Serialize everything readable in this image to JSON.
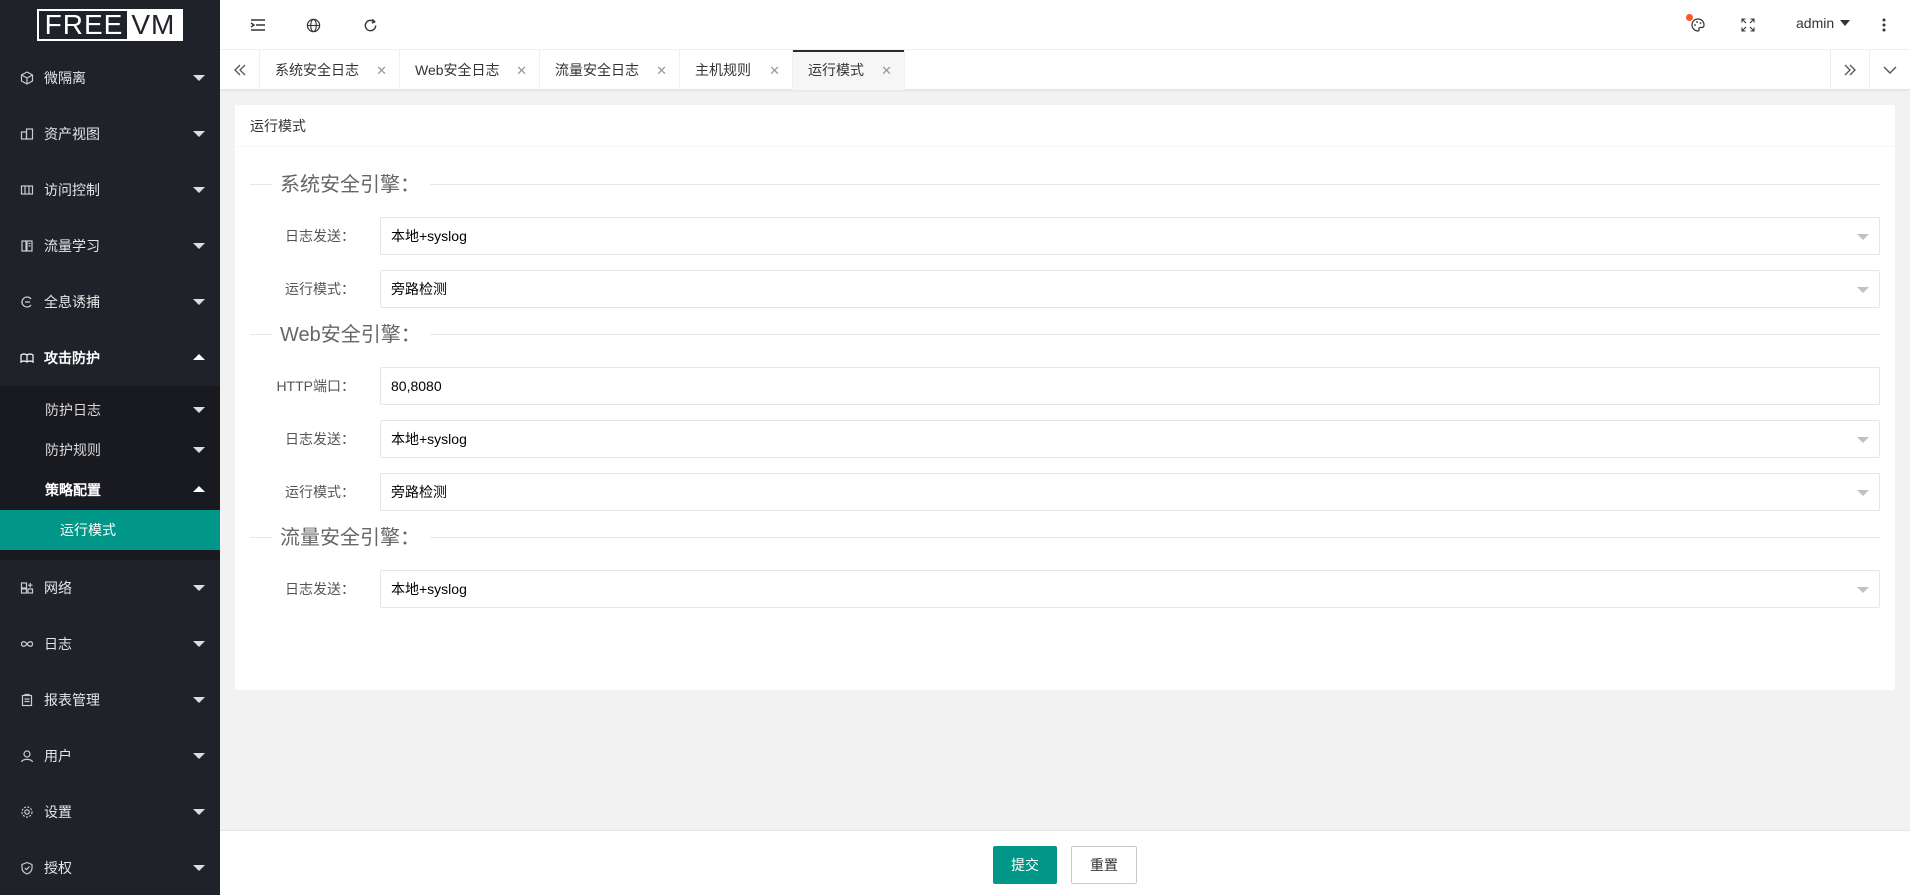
{
  "brand": {
    "part1": "FREE",
    "part2": "VM"
  },
  "sidebar": {
    "items": [
      {
        "label": "微隔离",
        "icon": "cube-icon"
      },
      {
        "label": "资产视图",
        "icon": "assets-icon"
      },
      {
        "label": "访问控制",
        "icon": "grid-icon"
      },
      {
        "label": "流量学习",
        "icon": "book-icon"
      },
      {
        "label": "全息诱捕",
        "icon": "trap-icon"
      },
      {
        "label": "攻击防护",
        "icon": "shield-book-icon"
      },
      {
        "label": "网络",
        "icon": "network-icon"
      },
      {
        "label": "日志",
        "icon": "infinity-icon"
      },
      {
        "label": "报表管理",
        "icon": "clipboard-icon"
      },
      {
        "label": "用户",
        "icon": "user-icon"
      },
      {
        "label": "设置",
        "icon": "gear-icon"
      },
      {
        "label": "授权",
        "icon": "check-shield-icon"
      }
    ],
    "sub": {
      "log": "防护日志",
      "rules": "防护规则",
      "policy": "策略配置",
      "run_mode": "运行模式"
    }
  },
  "header": {
    "user": "admin"
  },
  "tabs": [
    {
      "label": "系统安全日志"
    },
    {
      "label": "Web安全日志"
    },
    {
      "label": "流量安全日志"
    },
    {
      "label": "主机规则"
    },
    {
      "label": "运行模式"
    }
  ],
  "card": {
    "title": "运行模式",
    "sections": {
      "system": {
        "legend": "系统安全引擎：",
        "log_send_label": "日志发送：",
        "log_send_value": "本地+syslog",
        "run_mode_label": "运行模式：",
        "run_mode_value": "旁路检测"
      },
      "web": {
        "legend": "Web安全引擎：",
        "http_port_label": "HTTP端口：",
        "http_port_value": "80,8080",
        "log_send_label": "日志发送：",
        "log_send_value": "本地+syslog",
        "run_mode_label": "运行模式：",
        "run_mode_value": "旁路检测"
      },
      "flow": {
        "legend": "流量安全引擎：",
        "log_send_label": "日志发送：",
        "log_send_value": "本地+syslog"
      }
    }
  },
  "footer": {
    "submit": "提交",
    "reset": "重置"
  },
  "colors": {
    "accent": "#009688",
    "sidebar_bg": "#20222a",
    "notify_dot": "#ff5722"
  }
}
